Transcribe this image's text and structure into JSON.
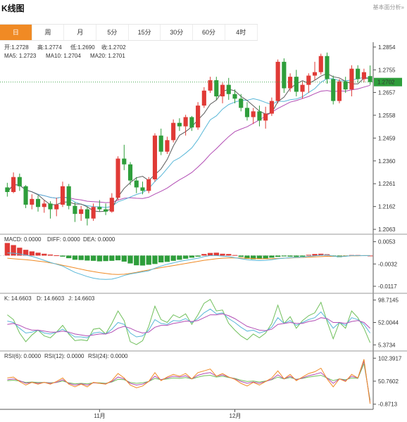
{
  "header": {
    "title": "K线图",
    "link": "基本面分析»"
  },
  "tabs": [
    {
      "label": "日",
      "active": true
    },
    {
      "label": "周",
      "active": false
    },
    {
      "label": "月",
      "active": false
    },
    {
      "label": "5分",
      "active": false
    },
    {
      "label": "15分",
      "active": false
    },
    {
      "label": "30分",
      "active": false
    },
    {
      "label": "60分",
      "active": false
    },
    {
      "label": "4时",
      "active": false
    }
  ],
  "colors": {
    "up": "#e03a36",
    "down": "#2e9e3b",
    "ma5": "#5b5b5b",
    "ma10": "#58b7d8",
    "ma20": "#b24db4",
    "price_tag": "#2e9e3b",
    "orange": "#f08a24"
  },
  "chart_data": [
    {
      "type": "candlestick",
      "legend": {
        "open": "开:1.2728",
        "high": "高:1.2774",
        "low": "低:1.2690",
        "close": "收:1.2702",
        "ma5": "MA5: 1.2723",
        "ma10": "MA10: 1.2704",
        "ma20": "MA20: 1.2701"
      },
      "last_price": "1.2702",
      "y_ticks": [
        "1.2854",
        "1.2755",
        "1.2657",
        "1.2558",
        "1.2459",
        "1.2360",
        "1.2261",
        "1.2162",
        "1.2063"
      ],
      "y_range": [
        1.2045,
        1.2875
      ],
      "x_labels": [
        {
          "label": "11月",
          "index": 15
        },
        {
          "label": "12月",
          "index": 37
        }
      ],
      "candles": [
        [
          1.2245,
          1.2265,
          1.2205,
          1.2225
        ],
        [
          1.2225,
          1.231,
          1.222,
          1.229
        ],
        [
          1.229,
          1.2305,
          1.223,
          1.225
        ],
        [
          1.225,
          1.2255,
          1.2155,
          1.217
        ],
        [
          1.217,
          1.2215,
          1.215,
          1.2195
        ],
        [
          1.2195,
          1.221,
          1.214,
          1.216
        ],
        [
          1.216,
          1.219,
          1.2135,
          1.2175
        ],
        [
          1.2175,
          1.2185,
          1.211,
          1.215
        ],
        [
          1.215,
          1.22,
          1.212,
          1.217
        ],
        [
          1.217,
          1.227,
          1.216,
          1.225
        ],
        [
          1.225,
          1.226,
          1.215,
          1.2165
        ],
        [
          1.2165,
          1.218,
          1.2095,
          1.213
        ],
        [
          1.213,
          1.2165,
          1.21,
          1.215
        ],
        [
          1.215,
          1.216,
          1.208,
          1.211
        ],
        [
          1.211,
          1.2175,
          1.21,
          1.216
        ],
        [
          1.216,
          1.219,
          1.214,
          1.215
        ],
        [
          1.215,
          1.2175,
          1.2125,
          1.214
        ],
        [
          1.214,
          1.222,
          1.2135,
          1.22
        ],
        [
          1.22,
          1.238,
          1.219,
          1.237
        ],
        [
          1.237,
          1.243,
          1.232,
          1.2345
        ],
        [
          1.2345,
          1.2355,
          1.2255,
          1.2275
        ],
        [
          1.2275,
          1.229,
          1.222,
          1.2245
        ],
        [
          1.2245,
          1.227,
          1.2215,
          1.223
        ],
        [
          1.223,
          1.229,
          1.222,
          1.228
        ],
        [
          1.228,
          1.248,
          1.227,
          1.247
        ],
        [
          1.247,
          1.25,
          1.2385,
          1.24
        ],
        [
          1.24,
          1.2465,
          1.239,
          1.245
        ],
        [
          1.245,
          1.254,
          1.244,
          1.2525
        ],
        [
          1.2525,
          1.2545,
          1.249,
          1.251
        ],
        [
          1.251,
          1.256,
          1.247,
          1.255
        ],
        [
          1.255,
          1.2555,
          1.249,
          1.2505
        ],
        [
          1.2505,
          1.2615,
          1.2495,
          1.26
        ],
        [
          1.26,
          1.268,
          1.259,
          1.2665
        ],
        [
          1.2665,
          1.2725,
          1.2655,
          1.271
        ],
        [
          1.271,
          1.2725,
          1.2625,
          1.264
        ],
        [
          1.264,
          1.27,
          1.261,
          1.269
        ],
        [
          1.269,
          1.272,
          1.2625,
          1.265
        ],
        [
          1.265,
          1.267,
          1.261,
          1.263
        ],
        [
          1.263,
          1.265,
          1.2575,
          1.259
        ],
        [
          1.259,
          1.2615,
          1.2535,
          1.255
        ],
        [
          1.255,
          1.259,
          1.252,
          1.2575
        ],
        [
          1.2575,
          1.26,
          1.251,
          1.2535
        ],
        [
          1.2535,
          1.2595,
          1.25,
          1.2565
        ],
        [
          1.2565,
          1.2635,
          1.2555,
          1.262
        ],
        [
          1.262,
          1.28,
          1.261,
          1.279
        ],
        [
          1.279,
          1.2805,
          1.2655,
          1.2675
        ],
        [
          1.2675,
          1.274,
          1.266,
          1.2725
        ],
        [
          1.2725,
          1.2755,
          1.264,
          1.266
        ],
        [
          1.266,
          1.2705,
          1.263,
          1.269
        ],
        [
          1.269,
          1.274,
          1.2655,
          1.273
        ],
        [
          1.273,
          1.279,
          1.271,
          1.2745
        ],
        [
          1.2745,
          1.2825,
          1.2735,
          1.2815
        ],
        [
          1.2815,
          1.283,
          1.2695,
          1.2715
        ],
        [
          1.2715,
          1.273,
          1.2605,
          1.262
        ],
        [
          1.262,
          1.2715,
          1.261,
          1.2705
        ],
        [
          1.2705,
          1.2725,
          1.2655,
          1.267
        ],
        [
          1.267,
          1.2775,
          1.264,
          1.276
        ],
        [
          1.276,
          1.2775,
          1.27,
          1.2715
        ],
        [
          1.2715,
          1.276,
          1.27,
          1.2745
        ],
        [
          1.2728,
          1.2774,
          1.269,
          1.2702
        ]
      ]
    },
    {
      "type": "bar",
      "name": "MACD",
      "legend": {
        "macd": "MACD: 0.0000",
        "diff": "DIFF: 0.0000",
        "dea": "DEA: 0.0000"
      },
      "y_ticks": [
        "0.0053",
        "-0.0032",
        "-0.0117"
      ],
      "y_range": [
        -0.0125,
        0.006
      ],
      "values": [
        0.0048,
        0.004,
        0.003,
        0.0022,
        0.0016,
        0.0011,
        0.0007,
        0.0004,
        0.0001,
        -0.0004,
        -0.001,
        -0.0016,
        -0.0017,
        -0.0019,
        -0.002,
        -0.0022,
        -0.0021,
        -0.002,
        -0.0018,
        -0.0023,
        -0.003,
        -0.0037,
        -0.0038,
        -0.0035,
        -0.0032,
        -0.0026,
        -0.0024,
        -0.002,
        -0.0016,
        -0.0012,
        -0.0008,
        -0.0004,
        0.0006,
        0.001,
        0.0011,
        0.0007,
        0.0006,
        0.0002,
        -0.0005,
        -0.0012,
        -0.0014,
        -0.0013,
        -0.0011,
        -0.0008,
        -0.0005,
        -0.0003,
        -0.0004,
        -0.0005,
        -0.0004,
        0.0003,
        0.0006,
        0.0007,
        0.0005,
        -0.0004,
        -0.0006,
        -0.0003,
        0.0002,
        0.0002,
        0.0001,
        0.0
      ],
      "diff": [
        0.001,
        0.0009,
        0.0006,
        0.0002,
        -0.0003,
        -0.001,
        -0.0018,
        -0.0026,
        -0.0033,
        -0.004,
        -0.0052,
        -0.0064,
        -0.0072,
        -0.008,
        -0.0086,
        -0.009,
        -0.0091,
        -0.009,
        -0.0084,
        -0.0076,
        -0.007,
        -0.0066,
        -0.0062,
        -0.0058,
        -0.0048,
        -0.004,
        -0.0033,
        -0.0028,
        -0.0022,
        -0.0018,
        -0.0014,
        -0.001,
        -0.0004,
        0.0,
        0.0,
        -0.0002,
        -0.0004,
        -0.0008,
        -0.0012,
        -0.0016,
        -0.0018,
        -0.0019,
        -0.0018,
        -0.0016,
        -0.0012,
        -0.001,
        -0.0008,
        -0.0007,
        -0.0006,
        -0.0003,
        -0.0001,
        0.0001,
        0.0002,
        -0.0002,
        -0.0004,
        -0.0003,
        0.0,
        0.0,
        0.0,
        0.0
      ],
      "dea": [
        -0.001,
        -0.0012,
        -0.0014,
        -0.0016,
        -0.0018,
        -0.0021,
        -0.0024,
        -0.0028,
        -0.0032,
        -0.0037,
        -0.0042,
        -0.0047,
        -0.0052,
        -0.0057,
        -0.0061,
        -0.0065,
        -0.0068,
        -0.0071,
        -0.0072,
        -0.0071,
        -0.0068,
        -0.0064,
        -0.0059,
        -0.0055,
        -0.005,
        -0.0046,
        -0.0042,
        -0.0038,
        -0.0034,
        -0.003,
        -0.0026,
        -0.0022,
        -0.0018,
        -0.0015,
        -0.0012,
        -0.001,
        -0.0009,
        -0.0009,
        -0.0009,
        -0.001,
        -0.0011,
        -0.0012,
        -0.0012,
        -0.0012,
        -0.0011,
        -0.001,
        -0.0009,
        -0.0008,
        -0.0007,
        -0.0006,
        -0.0005,
        -0.0004,
        -0.0003,
        -0.0003,
        -0.0003,
        -0.0002,
        -0.0001,
        -0.0001,
        0.0,
        0.0
      ]
    },
    {
      "type": "line",
      "name": "KDJ",
      "legend": {
        "k": "K: 14.6603",
        "d": "D: 14.6603",
        "j": "J: 14.6603"
      },
      "y_ticks": [
        "98.7145",
        "52.0044",
        "5.3734"
      ],
      "y_range": [
        0,
        104
      ],
      "k": [
        55,
        52,
        40,
        30,
        32,
        36,
        30,
        28,
        32,
        38,
        30,
        22,
        22,
        20,
        30,
        32,
        28,
        38,
        52,
        48,
        30,
        22,
        24,
        36,
        58,
        50,
        48,
        56,
        55,
        60,
        52,
        60,
        72,
        80,
        70,
        72,
        60,
        52,
        42,
        34,
        36,
        30,
        34,
        42,
        62,
        50,
        56,
        46,
        52,
        58,
        62,
        74,
        58,
        40,
        52,
        46,
        62,
        58,
        48,
        30
      ],
      "d": [
        48,
        50,
        46,
        40,
        36,
        36,
        34,
        32,
        32,
        34,
        32,
        28,
        26,
        24,
        26,
        28,
        28,
        32,
        40,
        44,
        40,
        34,
        30,
        32,
        42,
        46,
        46,
        50,
        52,
        55,
        54,
        56,
        62,
        68,
        68,
        70,
        66,
        60,
        52,
        44,
        40,
        36,
        35,
        38,
        48,
        50,
        52,
        50,
        50,
        54,
        56,
        62,
        60,
        52,
        52,
        50,
        54,
        56,
        52,
        40
      ],
      "j": [
        68,
        58,
        30,
        12,
        26,
        36,
        24,
        20,
        32,
        46,
        28,
        14,
        16,
        14,
        38,
        40,
        28,
        50,
        76,
        56,
        12,
        6,
        14,
        44,
        86,
        58,
        52,
        68,
        62,
        70,
        48,
        68,
        92,
        100,
        76,
        78,
        50,
        36,
        24,
        16,
        28,
        20,
        30,
        50,
        88,
        50,
        64,
        40,
        56,
        66,
        72,
        94,
        54,
        18,
        52,
        40,
        76,
        62,
        40,
        10
      ]
    },
    {
      "type": "line",
      "name": "RSI",
      "legend": {
        "rsi6": "RSI(6): 0.0000",
        "rsi12": "RSI(12): 0.0000",
        "rsi24": "RSI(24): 0.0000"
      },
      "y_ticks": [
        "102.3917",
        "50.7602",
        "-0.8713"
      ],
      "y_range": [
        -3,
        106
      ],
      "rsi6": [
        58,
        60,
        50,
        42,
        48,
        44,
        48,
        44,
        50,
        58,
        44,
        38,
        44,
        38,
        48,
        46,
        44,
        52,
        68,
        58,
        42,
        36,
        40,
        50,
        70,
        52,
        60,
        66,
        62,
        68,
        56,
        70,
        74,
        78,
        62,
        68,
        60,
        55,
        46,
        40,
        48,
        42,
        50,
        58,
        74,
        56,
        66,
        52,
        60,
        68,
        72,
        80,
        56,
        38,
        56,
        50,
        66,
        58,
        100,
        0
      ],
      "rsi12": [
        54,
        56,
        52,
        46,
        48,
        46,
        48,
        46,
        48,
        54,
        46,
        42,
        45,
        42,
        47,
        46,
        45,
        50,
        60,
        56,
        46,
        42,
        44,
        50,
        62,
        54,
        58,
        62,
        60,
        63,
        56,
        64,
        68,
        70,
        62,
        65,
        60,
        56,
        50,
        46,
        49,
        46,
        50,
        55,
        65,
        56,
        62,
        54,
        58,
        63,
        66,
        70,
        58,
        46,
        56,
        52,
        62,
        58,
        96,
        4
      ],
      "rsi24": [
        52,
        53,
        51,
        48,
        49,
        48,
        48,
        47,
        48,
        51,
        47,
        45,
        46,
        45,
        47,
        47,
        46,
        49,
        55,
        54,
        48,
        46,
        47,
        50,
        57,
        54,
        56,
        58,
        57,
        59,
        56,
        60,
        63,
        64,
        60,
        62,
        59,
        57,
        53,
        50,
        51,
        49,
        51,
        54,
        60,
        56,
        59,
        55,
        57,
        60,
        62,
        64,
        58,
        52,
        56,
        54,
        58,
        57,
        90,
        8
      ]
    }
  ]
}
